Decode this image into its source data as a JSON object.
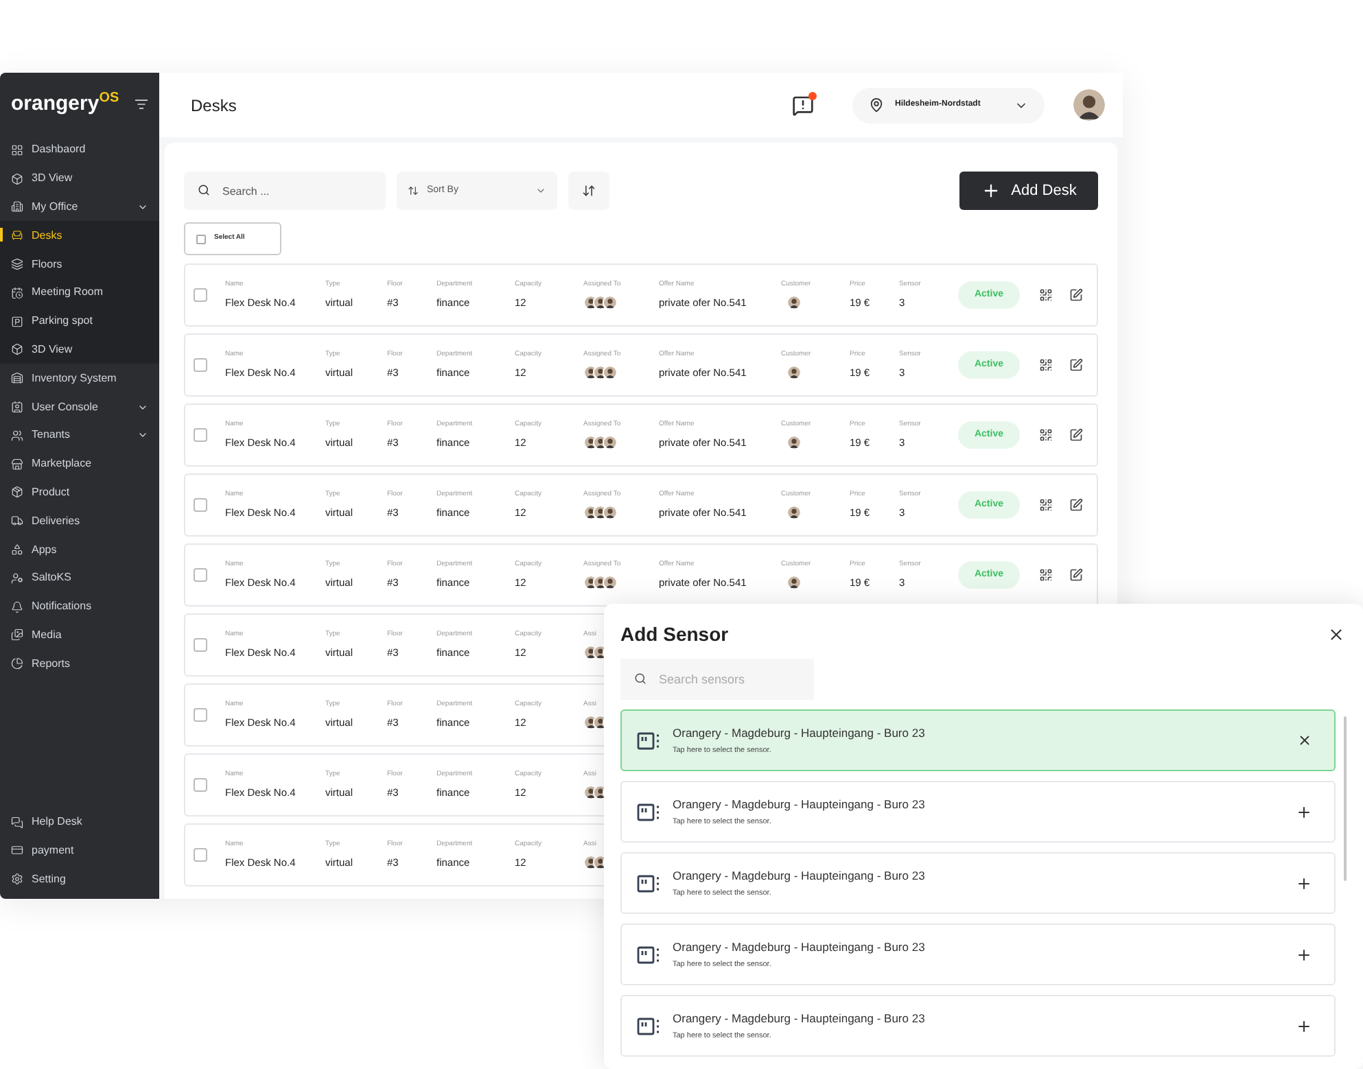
{
  "sidebar": {
    "logo": "orangery",
    "logo_suffix": "OS",
    "items": [
      {
        "label": "Dashbaord",
        "selected": false,
        "expandable": false
      },
      {
        "label": "3D View",
        "selected": false,
        "expandable": false
      },
      {
        "label": "My Office",
        "selected": false,
        "expandable": true,
        "children": [
          {
            "label": "Desks",
            "selected": true
          },
          {
            "label": "Floors",
            "selected": false
          },
          {
            "label": "Meeting Room",
            "selected": false
          },
          {
            "label": "Parking spot",
            "selected": false
          },
          {
            "label": "3D View",
            "selected": false
          }
        ]
      },
      {
        "label": "Inventory System",
        "selected": false,
        "expandable": false
      },
      {
        "label": "User Console",
        "selected": false,
        "expandable": true
      },
      {
        "label": "Tenants",
        "selected": false,
        "expandable": true
      },
      {
        "label": "Marketplace",
        "selected": false,
        "expandable": false
      },
      {
        "label": "Product",
        "selected": false,
        "expandable": false
      },
      {
        "label": "Deliveries",
        "selected": false,
        "expandable": false
      },
      {
        "label": "Apps",
        "selected": false,
        "expandable": false
      },
      {
        "label": "SaltoKS",
        "selected": false,
        "expandable": false
      },
      {
        "label": "Notifications",
        "selected": false,
        "expandable": false
      },
      {
        "label": "Media",
        "selected": false,
        "expandable": false
      },
      {
        "label": "Reports",
        "selected": false,
        "expandable": false
      }
    ],
    "bottom_items": [
      {
        "label": "Help Desk"
      },
      {
        "label": "payment"
      },
      {
        "label": "Setting"
      }
    ]
  },
  "header": {
    "title": "Desks",
    "has_notification": true,
    "location": "Hildesheim-Nordstadt"
  },
  "toolbar": {
    "search": {
      "placeholder": "Search ..."
    },
    "sort": "Sort By",
    "add_button": "Add Desk",
    "select_all": {
      "label": "Select All",
      "checked": false
    }
  },
  "rows": [
    {
      "checked": false,
      "status": "Active",
      "cells": [
        {
          "kind": "text",
          "label": "Name",
          "value": "Flex Desk No.4"
        },
        {
          "kind": "text",
          "label": "Type",
          "value": "virtual"
        },
        {
          "kind": "text",
          "label": "Floor",
          "value": "#3"
        },
        {
          "kind": "text",
          "label": "Department",
          "value": "finance"
        },
        {
          "kind": "text",
          "label": "Capacity",
          "value": "12"
        },
        {
          "kind": "avatars",
          "label": "Assigned To"
        },
        {
          "kind": "text",
          "label": "Offer Name",
          "value": "private ofer No.541"
        },
        {
          "kind": "avatar",
          "label": "Customer"
        },
        {
          "kind": "text",
          "label": "Price",
          "value": "19 €"
        },
        {
          "kind": "text",
          "label": "Sensor",
          "value": "3"
        }
      ]
    },
    {
      "checked": false,
      "status": "Active",
      "cells": [
        {
          "kind": "text",
          "label": "Name",
          "value": "Flex Desk No.4"
        },
        {
          "kind": "text",
          "label": "Type",
          "value": "virtual"
        },
        {
          "kind": "text",
          "label": "Floor",
          "value": "#3"
        },
        {
          "kind": "text",
          "label": "Department",
          "value": "finance"
        },
        {
          "kind": "text",
          "label": "Capacity",
          "value": "12"
        },
        {
          "kind": "avatars",
          "label": "Assigned To"
        },
        {
          "kind": "text",
          "label": "Offer Name",
          "value": "private ofer No.541"
        },
        {
          "kind": "avatar",
          "label": "Customer"
        },
        {
          "kind": "text",
          "label": "Price",
          "value": "19 €"
        },
        {
          "kind": "text",
          "label": "Sensor",
          "value": "3"
        }
      ]
    },
    {
      "checked": false,
      "status": "Active",
      "cells": [
        {
          "kind": "text",
          "label": "Name",
          "value": "Flex Desk No.4"
        },
        {
          "kind": "text",
          "label": "Type",
          "value": "virtual"
        },
        {
          "kind": "text",
          "label": "Floor",
          "value": "#3"
        },
        {
          "kind": "text",
          "label": "Department",
          "value": "finance"
        },
        {
          "kind": "text",
          "label": "Capacity",
          "value": "12"
        },
        {
          "kind": "avatars",
          "label": "Assigned To"
        },
        {
          "kind": "text",
          "label": "Offer Name",
          "value": "private ofer No.541"
        },
        {
          "kind": "avatar",
          "label": "Customer"
        },
        {
          "kind": "text",
          "label": "Price",
          "value": "19 €"
        },
        {
          "kind": "text",
          "label": "Sensor",
          "value": "3"
        }
      ]
    },
    {
      "checked": false,
      "status": "Active",
      "cells": [
        {
          "kind": "text",
          "label": "Name",
          "value": "Flex Desk No.4"
        },
        {
          "kind": "text",
          "label": "Type",
          "value": "virtual"
        },
        {
          "kind": "text",
          "label": "Floor",
          "value": "#3"
        },
        {
          "kind": "text",
          "label": "Department",
          "value": "finance"
        },
        {
          "kind": "text",
          "label": "Capacity",
          "value": "12"
        },
        {
          "kind": "avatars",
          "label": "Assigned To"
        },
        {
          "kind": "text",
          "label": "Offer Name",
          "value": "private ofer No.541"
        },
        {
          "kind": "avatar",
          "label": "Customer"
        },
        {
          "kind": "text",
          "label": "Price",
          "value": "19 €"
        },
        {
          "kind": "text",
          "label": "Sensor",
          "value": "3"
        }
      ]
    },
    {
      "checked": false,
      "status": "Active",
      "cells": [
        {
          "kind": "text",
          "label": "Name",
          "value": "Flex Desk No.4"
        },
        {
          "kind": "text",
          "label": "Type",
          "value": "virtual"
        },
        {
          "kind": "text",
          "label": "Floor",
          "value": "#3"
        },
        {
          "kind": "text",
          "label": "Department",
          "value": "finance"
        },
        {
          "kind": "text",
          "label": "Capacity",
          "value": "12"
        },
        {
          "kind": "avatars",
          "label": "Assigned To"
        },
        {
          "kind": "text",
          "label": "Offer Name",
          "value": "private ofer No.541"
        },
        {
          "kind": "avatar",
          "label": "Customer"
        },
        {
          "kind": "text",
          "label": "Price",
          "value": "19 €"
        },
        {
          "kind": "text",
          "label": "Sensor",
          "value": "3"
        }
      ]
    },
    {
      "checked": false,
      "cells": [
        {
          "kind": "text",
          "label": "Name",
          "value": "Flex Desk No.4"
        },
        {
          "kind": "text",
          "label": "Type",
          "value": "virtual"
        },
        {
          "kind": "text",
          "label": "Floor",
          "value": "#3"
        },
        {
          "kind": "text",
          "label": "Department",
          "value": "finance"
        },
        {
          "kind": "text",
          "label": "Capacity",
          "value": "12"
        },
        {
          "kind": "avatars",
          "label": "Assi"
        }
      ]
    },
    {
      "checked": false,
      "cells": [
        {
          "kind": "text",
          "label": "Name",
          "value": "Flex Desk No.4"
        },
        {
          "kind": "text",
          "label": "Type",
          "value": "virtual"
        },
        {
          "kind": "text",
          "label": "Floor",
          "value": "#3"
        },
        {
          "kind": "text",
          "label": "Department",
          "value": "finance"
        },
        {
          "kind": "text",
          "label": "Capacity",
          "value": "12"
        },
        {
          "kind": "avatars",
          "label": "Assi"
        }
      ]
    },
    {
      "checked": false,
      "cells": [
        {
          "kind": "text",
          "label": "Name",
          "value": "Flex Desk No.4"
        },
        {
          "kind": "text",
          "label": "Type",
          "value": "virtual"
        },
        {
          "kind": "text",
          "label": "Floor",
          "value": "#3"
        },
        {
          "kind": "text",
          "label": "Department",
          "value": "finance"
        },
        {
          "kind": "text",
          "label": "Capacity",
          "value": "12"
        },
        {
          "kind": "avatars",
          "label": "Assi"
        }
      ]
    },
    {
      "checked": false,
      "cells": [
        {
          "kind": "text",
          "label": "Name",
          "value": "Flex Desk No.4"
        },
        {
          "kind": "text",
          "label": "Type",
          "value": "virtual"
        },
        {
          "kind": "text",
          "label": "Floor",
          "value": "#3"
        },
        {
          "kind": "text",
          "label": "Department",
          "value": "finance"
        },
        {
          "kind": "text",
          "label": "Capacity",
          "value": "12"
        },
        {
          "kind": "avatars",
          "label": "Assi"
        }
      ]
    }
  ],
  "dialog": {
    "title": "Add Sensor",
    "search": {
      "placeholder": "Search sensors"
    },
    "sensors": [
      {
        "name": "Orangery - Magdeburg - Haupteingang - Buro 23",
        "hint": "Tap here to select the sensor.",
        "selected": true
      },
      {
        "name": "Orangery - Magdeburg - Haupteingang - Buro 23",
        "hint": "Tap here to select the sensor.",
        "selected": false
      },
      {
        "name": "Orangery - Magdeburg - Haupteingang - Buro 23",
        "hint": "Tap here to select the sensor.",
        "selected": false
      },
      {
        "name": "Orangery - Magdeburg - Haupteingang - Buro 23",
        "hint": "Tap here to select the sensor.",
        "selected": false
      },
      {
        "name": "Orangery - Magdeburg - Haupteingang - Buro 23",
        "hint": "Tap here to select the sensor.",
        "selected": false
      }
    ]
  }
}
